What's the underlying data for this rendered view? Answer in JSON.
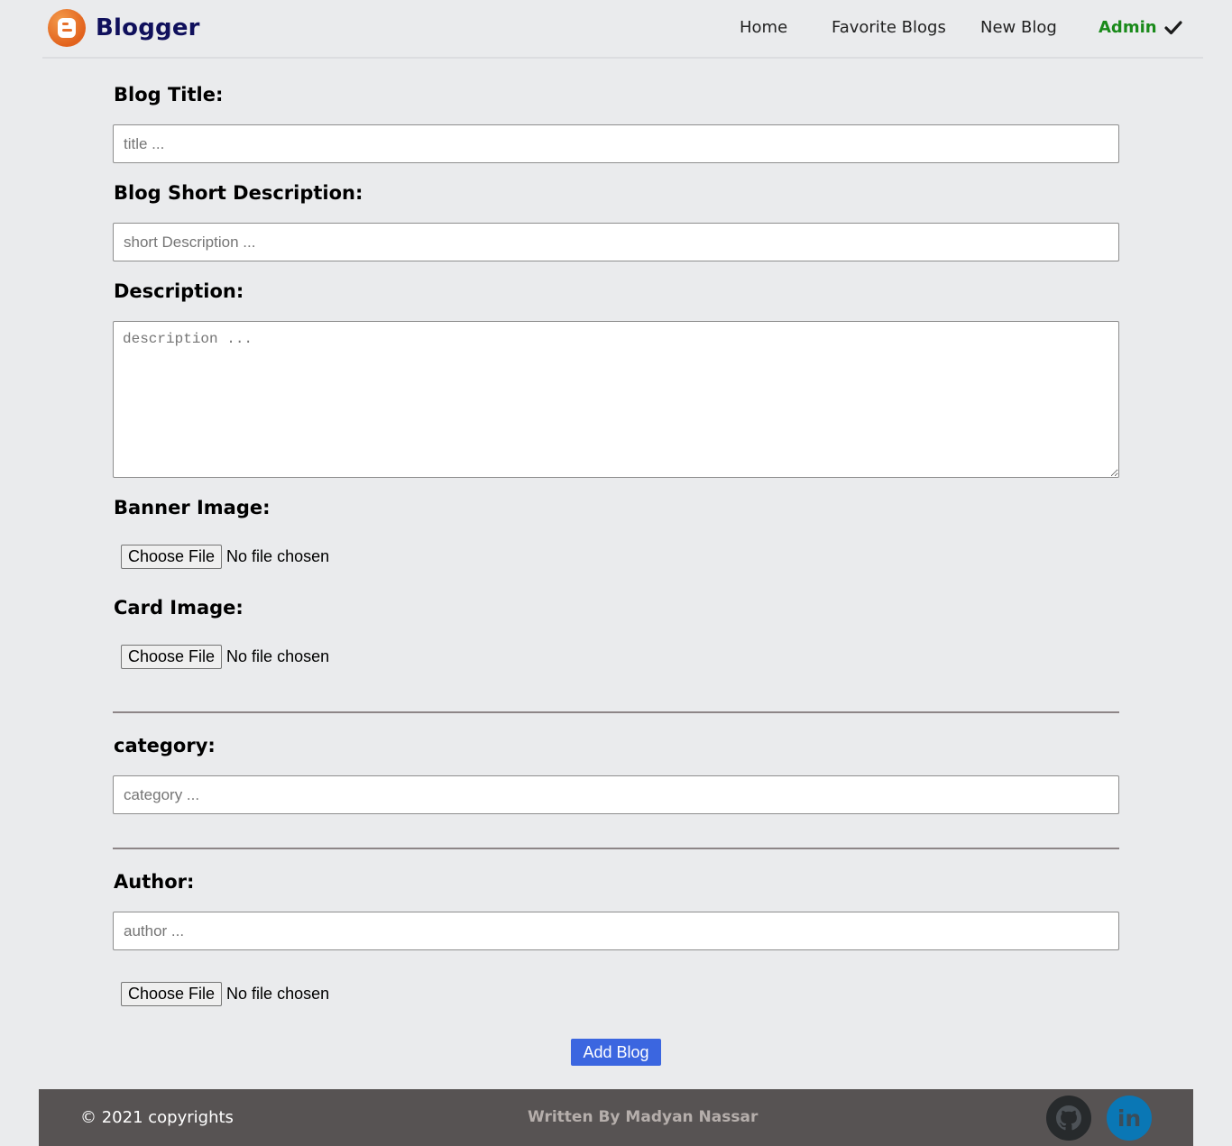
{
  "navbar": {
    "brand": "Blogger",
    "links": [
      "Home",
      "Favorite Blogs",
      "New Blog"
    ],
    "admin": "Admin"
  },
  "form": {
    "title_label": "Blog Title:",
    "title_placeholder": "title ...",
    "short_label": "Blog Short Description:",
    "short_placeholder": "short Description ...",
    "description_label": "Description:",
    "description_placeholder": "description ...",
    "banner_label": "Banner Image:",
    "card_label": "Card Image:",
    "category_label": "category:",
    "category_placeholder": "category ...",
    "author_label": "Author:",
    "author_placeholder": "author ...",
    "file_button": "Choose File",
    "file_status": "No file chosen",
    "submit": "Add Blog"
  },
  "footer": {
    "copyright": "© 2021 copyrights",
    "written_by": "Written By Madyan Nassar",
    "linkedin": "in"
  },
  "colors": {
    "background": "#eaebed",
    "brand": "#10105c",
    "admin": "#1a8a1a",
    "submit": "#3b66e0",
    "footer": "#575353"
  },
  "icons": [
    "blogger-logo-icon",
    "check-icon",
    "github-icon",
    "linkedin-icon"
  ]
}
